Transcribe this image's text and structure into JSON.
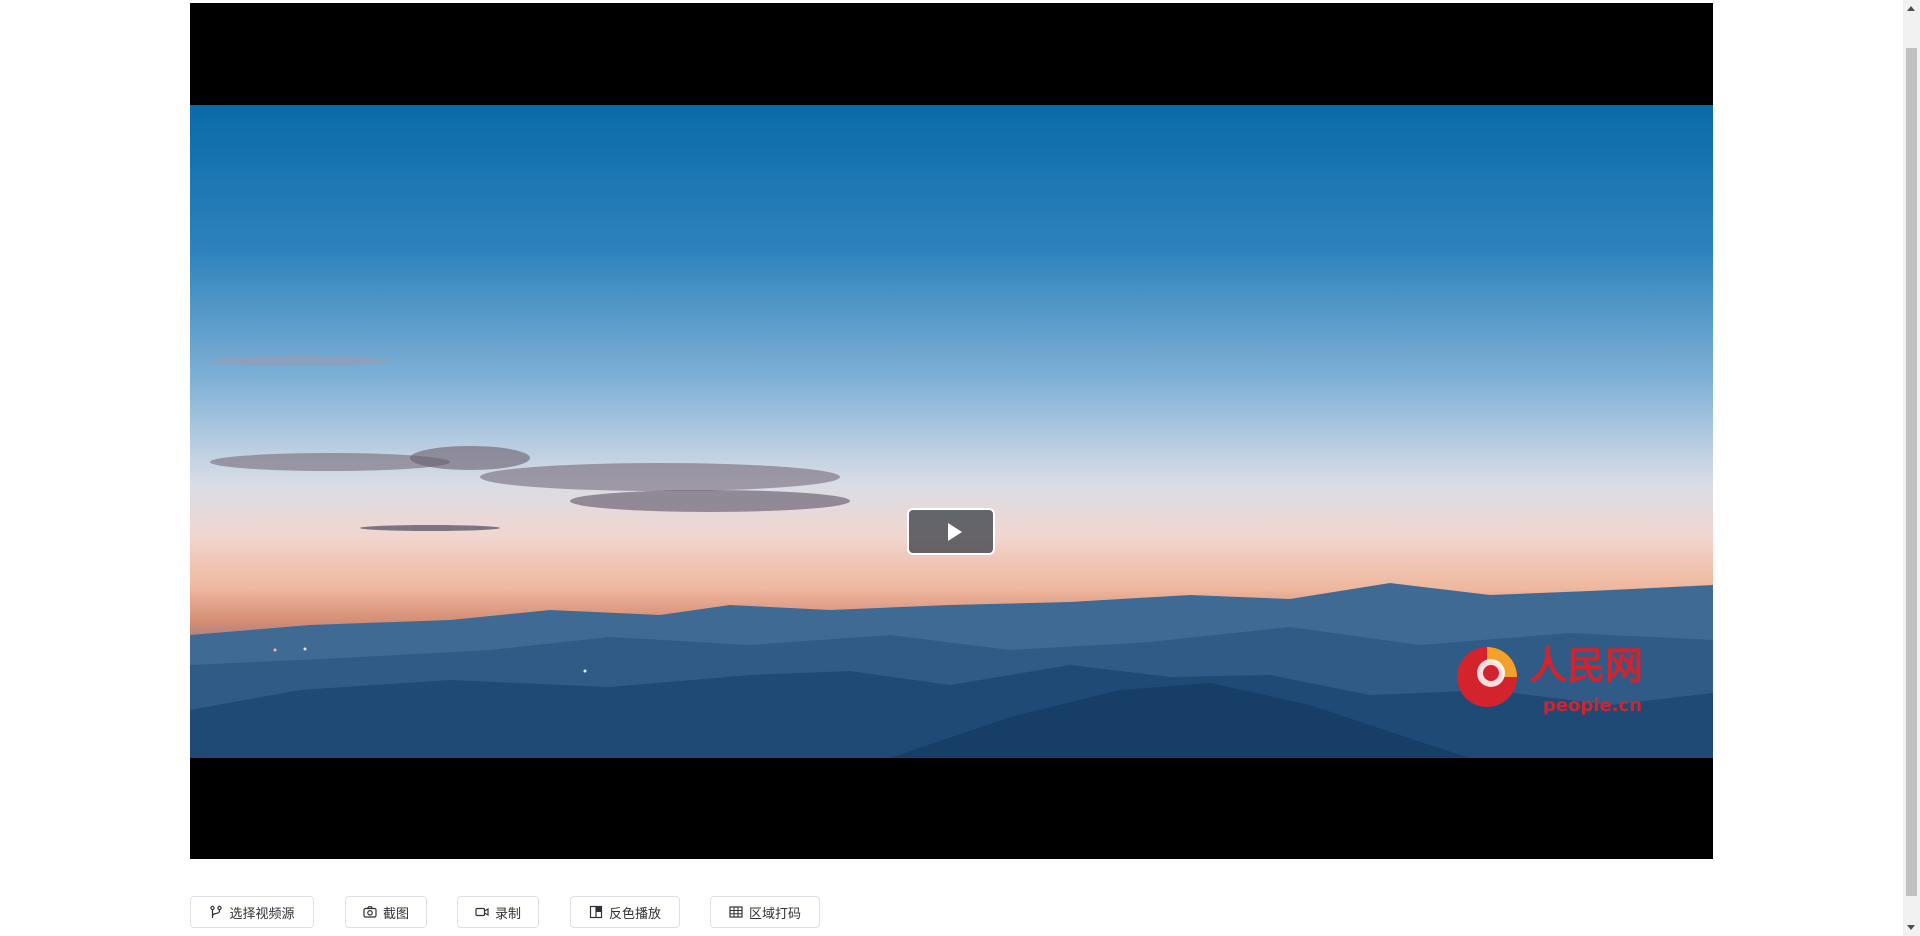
{
  "player": {
    "play_icon": "play-icon",
    "watermark": {
      "chinese": "人民网",
      "latin": "people.cn",
      "color": "#d3232c",
      "accent": "#f2a22b"
    }
  },
  "toolbar": {
    "buttons": [
      {
        "label": "选择视频源",
        "icon": "branch-icon"
      },
      {
        "label": "截图",
        "icon": "camera-icon"
      },
      {
        "label": "录制",
        "icon": "video-camera-icon"
      },
      {
        "label": "反色播放",
        "icon": "invert-icon"
      },
      {
        "label": "区域打码",
        "icon": "grid-icon"
      }
    ]
  },
  "colors": {
    "page_background": "#ffffff",
    "button_border": "#dcdfe6",
    "button_text": "#303133"
  }
}
